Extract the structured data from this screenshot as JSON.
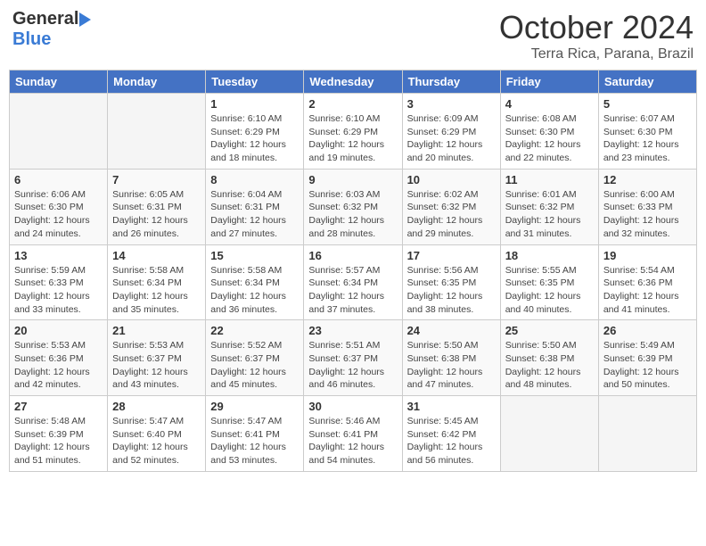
{
  "header": {
    "logo_general": "General",
    "logo_blue": "Blue",
    "title": "October 2024",
    "subtitle": "Terra Rica, Parana, Brazil"
  },
  "calendar": {
    "days_of_week": [
      "Sunday",
      "Monday",
      "Tuesday",
      "Wednesday",
      "Thursday",
      "Friday",
      "Saturday"
    ],
    "weeks": [
      [
        {
          "day": "",
          "sunrise": "",
          "sunset": "",
          "daylight": ""
        },
        {
          "day": "",
          "sunrise": "",
          "sunset": "",
          "daylight": ""
        },
        {
          "day": "1",
          "sunrise": "Sunrise: 6:10 AM",
          "sunset": "Sunset: 6:29 PM",
          "daylight": "Daylight: 12 hours and 18 minutes."
        },
        {
          "day": "2",
          "sunrise": "Sunrise: 6:10 AM",
          "sunset": "Sunset: 6:29 PM",
          "daylight": "Daylight: 12 hours and 19 minutes."
        },
        {
          "day": "3",
          "sunrise": "Sunrise: 6:09 AM",
          "sunset": "Sunset: 6:29 PM",
          "daylight": "Daylight: 12 hours and 20 minutes."
        },
        {
          "day": "4",
          "sunrise": "Sunrise: 6:08 AM",
          "sunset": "Sunset: 6:30 PM",
          "daylight": "Daylight: 12 hours and 22 minutes."
        },
        {
          "day": "5",
          "sunrise": "Sunrise: 6:07 AM",
          "sunset": "Sunset: 6:30 PM",
          "daylight": "Daylight: 12 hours and 23 minutes."
        }
      ],
      [
        {
          "day": "6",
          "sunrise": "Sunrise: 6:06 AM",
          "sunset": "Sunset: 6:30 PM",
          "daylight": "Daylight: 12 hours and 24 minutes."
        },
        {
          "day": "7",
          "sunrise": "Sunrise: 6:05 AM",
          "sunset": "Sunset: 6:31 PM",
          "daylight": "Daylight: 12 hours and 26 minutes."
        },
        {
          "day": "8",
          "sunrise": "Sunrise: 6:04 AM",
          "sunset": "Sunset: 6:31 PM",
          "daylight": "Daylight: 12 hours and 27 minutes."
        },
        {
          "day": "9",
          "sunrise": "Sunrise: 6:03 AM",
          "sunset": "Sunset: 6:32 PM",
          "daylight": "Daylight: 12 hours and 28 minutes."
        },
        {
          "day": "10",
          "sunrise": "Sunrise: 6:02 AM",
          "sunset": "Sunset: 6:32 PM",
          "daylight": "Daylight: 12 hours and 29 minutes."
        },
        {
          "day": "11",
          "sunrise": "Sunrise: 6:01 AM",
          "sunset": "Sunset: 6:32 PM",
          "daylight": "Daylight: 12 hours and 31 minutes."
        },
        {
          "day": "12",
          "sunrise": "Sunrise: 6:00 AM",
          "sunset": "Sunset: 6:33 PM",
          "daylight": "Daylight: 12 hours and 32 minutes."
        }
      ],
      [
        {
          "day": "13",
          "sunrise": "Sunrise: 5:59 AM",
          "sunset": "Sunset: 6:33 PM",
          "daylight": "Daylight: 12 hours and 33 minutes."
        },
        {
          "day": "14",
          "sunrise": "Sunrise: 5:58 AM",
          "sunset": "Sunset: 6:34 PM",
          "daylight": "Daylight: 12 hours and 35 minutes."
        },
        {
          "day": "15",
          "sunrise": "Sunrise: 5:58 AM",
          "sunset": "Sunset: 6:34 PM",
          "daylight": "Daylight: 12 hours and 36 minutes."
        },
        {
          "day": "16",
          "sunrise": "Sunrise: 5:57 AM",
          "sunset": "Sunset: 6:34 PM",
          "daylight": "Daylight: 12 hours and 37 minutes."
        },
        {
          "day": "17",
          "sunrise": "Sunrise: 5:56 AM",
          "sunset": "Sunset: 6:35 PM",
          "daylight": "Daylight: 12 hours and 38 minutes."
        },
        {
          "day": "18",
          "sunrise": "Sunrise: 5:55 AM",
          "sunset": "Sunset: 6:35 PM",
          "daylight": "Daylight: 12 hours and 40 minutes."
        },
        {
          "day": "19",
          "sunrise": "Sunrise: 5:54 AM",
          "sunset": "Sunset: 6:36 PM",
          "daylight": "Daylight: 12 hours and 41 minutes."
        }
      ],
      [
        {
          "day": "20",
          "sunrise": "Sunrise: 5:53 AM",
          "sunset": "Sunset: 6:36 PM",
          "daylight": "Daylight: 12 hours and 42 minutes."
        },
        {
          "day": "21",
          "sunrise": "Sunrise: 5:53 AM",
          "sunset": "Sunset: 6:37 PM",
          "daylight": "Daylight: 12 hours and 43 minutes."
        },
        {
          "day": "22",
          "sunrise": "Sunrise: 5:52 AM",
          "sunset": "Sunset: 6:37 PM",
          "daylight": "Daylight: 12 hours and 45 minutes."
        },
        {
          "day": "23",
          "sunrise": "Sunrise: 5:51 AM",
          "sunset": "Sunset: 6:37 PM",
          "daylight": "Daylight: 12 hours and 46 minutes."
        },
        {
          "day": "24",
          "sunrise": "Sunrise: 5:50 AM",
          "sunset": "Sunset: 6:38 PM",
          "daylight": "Daylight: 12 hours and 47 minutes."
        },
        {
          "day": "25",
          "sunrise": "Sunrise: 5:50 AM",
          "sunset": "Sunset: 6:38 PM",
          "daylight": "Daylight: 12 hours and 48 minutes."
        },
        {
          "day": "26",
          "sunrise": "Sunrise: 5:49 AM",
          "sunset": "Sunset: 6:39 PM",
          "daylight": "Daylight: 12 hours and 50 minutes."
        }
      ],
      [
        {
          "day": "27",
          "sunrise": "Sunrise: 5:48 AM",
          "sunset": "Sunset: 6:39 PM",
          "daylight": "Daylight: 12 hours and 51 minutes."
        },
        {
          "day": "28",
          "sunrise": "Sunrise: 5:47 AM",
          "sunset": "Sunset: 6:40 PM",
          "daylight": "Daylight: 12 hours and 52 minutes."
        },
        {
          "day": "29",
          "sunrise": "Sunrise: 5:47 AM",
          "sunset": "Sunset: 6:41 PM",
          "daylight": "Daylight: 12 hours and 53 minutes."
        },
        {
          "day": "30",
          "sunrise": "Sunrise: 5:46 AM",
          "sunset": "Sunset: 6:41 PM",
          "daylight": "Daylight: 12 hours and 54 minutes."
        },
        {
          "day": "31",
          "sunrise": "Sunrise: 5:45 AM",
          "sunset": "Sunset: 6:42 PM",
          "daylight": "Daylight: 12 hours and 56 minutes."
        },
        {
          "day": "",
          "sunrise": "",
          "sunset": "",
          "daylight": ""
        },
        {
          "day": "",
          "sunrise": "",
          "sunset": "",
          "daylight": ""
        }
      ]
    ]
  }
}
